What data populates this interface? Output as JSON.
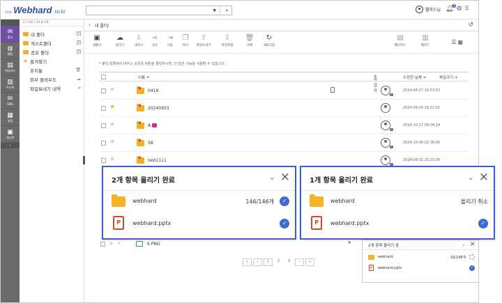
{
  "header": {
    "logo_only": "Only",
    "logo_brand": "Webhard",
    "logo_tld": ".co.kr",
    "search_value": "",
    "user_name": "웹하드님",
    "notification_count": "3"
  },
  "rail": {
    "items": [
      {
        "label": "폴더",
        "icon": "mail-icon"
      },
      {
        "label": "웹합",
        "icon": "globe-icon"
      },
      {
        "label": "백업하드",
        "icon": "server-icon"
      },
      {
        "label": "주소록",
        "icon": "contacts-icon"
      },
      {
        "label": "SMS",
        "icon": "envelope-icon"
      },
      {
        "label": "일정",
        "icon": "calendar-icon"
      },
      {
        "label": "게시판",
        "icon": "board-icon"
      }
    ]
  },
  "sidebar": {
    "storage_used": "3.7 GB",
    "storage_total": "10.8 GB",
    "items": [
      {
        "label": "내 폴더"
      },
      {
        "label": "게스트폴더"
      },
      {
        "label": "공유 폴더"
      },
      {
        "label": "즐겨찾기"
      },
      {
        "label": "휴지통"
      },
      {
        "label": "외부 클라우드"
      },
      {
        "label": "파일보내기 내역"
      }
    ]
  },
  "path": {
    "current": "내 폴더/"
  },
  "toolbar": {
    "new_folder": "새폴더",
    "upload": "올리기",
    "download": "내리기",
    "share": "공유",
    "move": "이동",
    "copy": "복사",
    "send_file": "파일보내기",
    "merge_file": "파일취합",
    "delete": "삭제",
    "refresh": "새로고침",
    "web_office": "웹오피스",
    "web_hard": "웹하드"
  },
  "notice": "* 폴더 목록에서 마우스 오른쪽 버튼을 클릭하시면, 더 많은 기능을 사용할 수 있습니다.",
  "table": {
    "col_name": "이름 ≑",
    "col_author": "작업자",
    "col_date": "수정한 날짜 ≑",
    "col_size": "파일크기 ≑",
    "rows": [
      {
        "name": "0419",
        "date": "2024-08-27 16:53:52",
        "starred": false
      },
      {
        "name": "20240503",
        "date": "2024-09-24 16:22:51",
        "starred": true
      },
      {
        "name": "A",
        "date": "2024-10-17 09:34:14",
        "starred": false
      },
      {
        "name": "58",
        "date": "2024-10-08 02:36:05",
        "starred": false
      },
      {
        "name": "test1111",
        "date": "2024-08-02 15:33:39",
        "starred": false
      }
    ],
    "partial_row_name": "6.PNG"
  },
  "popup_done_1": {
    "title": "2개 항목 올리기 완료",
    "folder_name": "webhard",
    "folder_status": "146/146개",
    "file_name": "webhard.pptx"
  },
  "popup_done_2": {
    "title": "1개 항목 올리기 완료",
    "folder_name": "webhard",
    "folder_status": "올리기 취소",
    "file_name": "webhard.pptx"
  },
  "mini_popup": {
    "title": "2개 항목 올리기 중",
    "folder_name": "webhard",
    "folder_status": "16/146개",
    "file_name": "webhard.pptx"
  },
  "pager": {
    "first": "«",
    "prev": "‹",
    "pages": [
      "1",
      "2",
      "3"
    ],
    "next": "›",
    "last": "»"
  },
  "colors": {
    "accent": "#3d5fbf",
    "folder": "#f3b027",
    "rail": "#6b6b6b",
    "rail_active": "#6f4fa8"
  }
}
